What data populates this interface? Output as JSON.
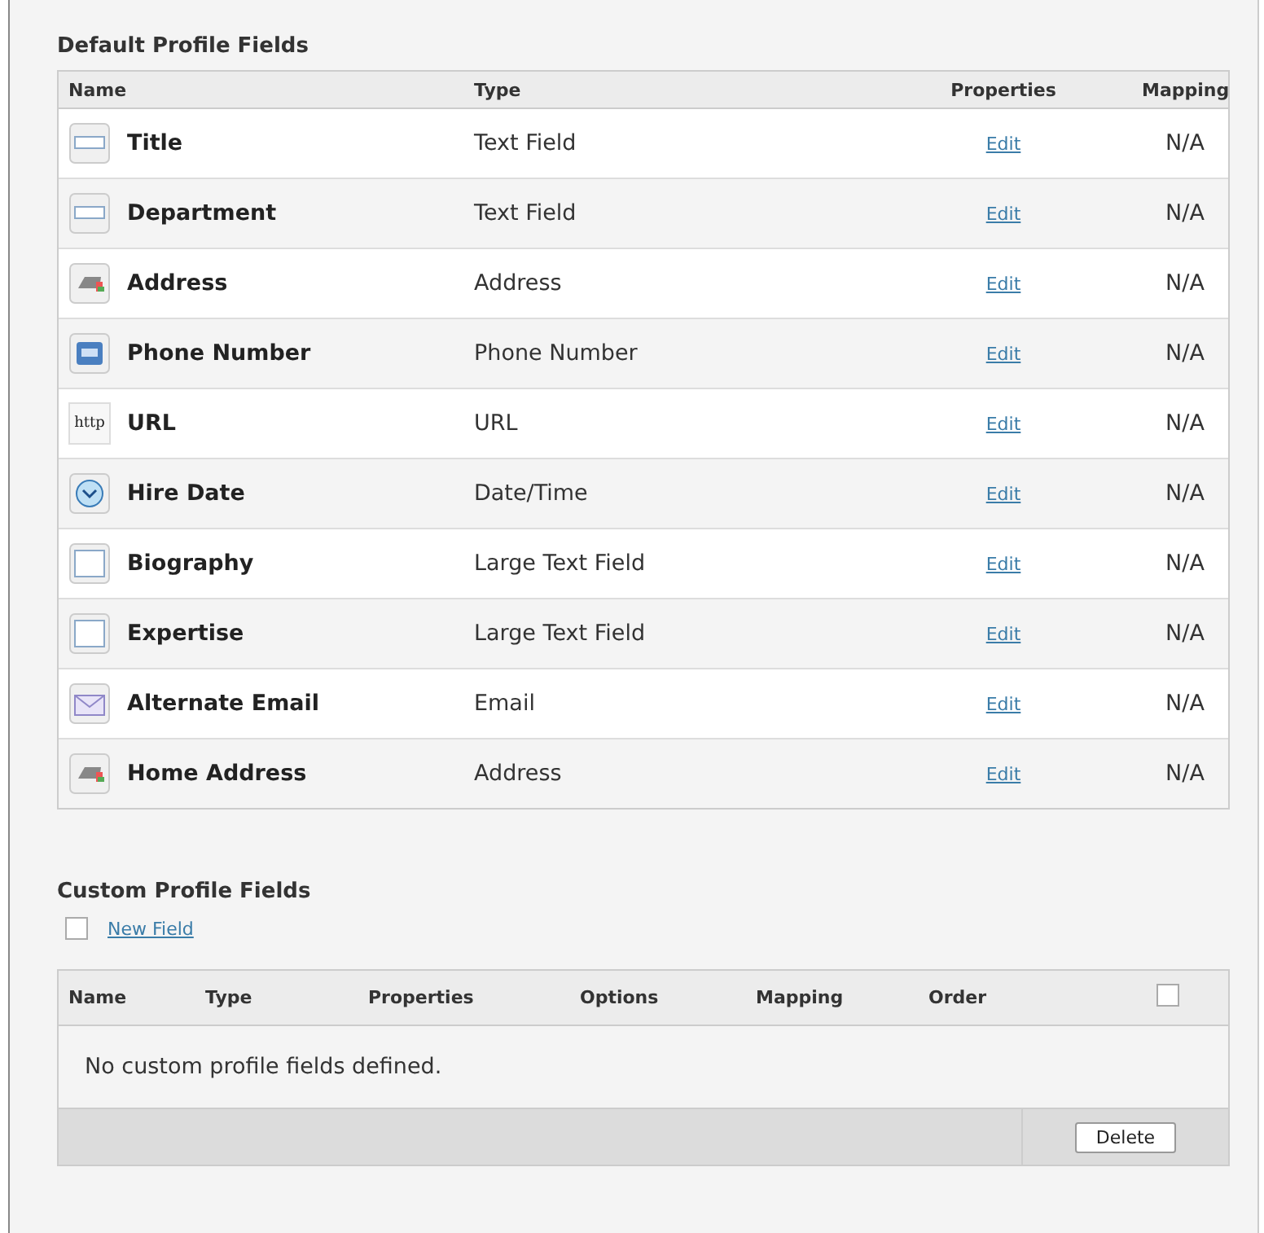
{
  "default_section": {
    "title": "Default Profile Fields",
    "columns": [
      "Name",
      "Type",
      "Properties",
      "Mapping"
    ],
    "rows": [
      {
        "kind": "text",
        "name": "Title",
        "type": "Text Field",
        "properties": "Edit",
        "mapping": "N/A"
      },
      {
        "kind": "text",
        "name": "Department",
        "type": "Text Field",
        "properties": "Edit",
        "mapping": "N/A"
      },
      {
        "kind": "address",
        "name": "Address",
        "type": "Address",
        "properties": "Edit",
        "mapping": "N/A"
      },
      {
        "kind": "phone",
        "name": "Phone Number",
        "type": "Phone Number",
        "properties": "Edit",
        "mapping": "N/A"
      },
      {
        "kind": "url",
        "name": "URL",
        "type": "URL",
        "properties": "Edit",
        "mapping": "N/A",
        "icon_text": "http"
      },
      {
        "kind": "date",
        "name": "Hire Date",
        "type": "Date/Time",
        "properties": "Edit",
        "mapping": "N/A"
      },
      {
        "kind": "textarea",
        "name": "Biography",
        "type": "Large Text Field",
        "properties": "Edit",
        "mapping": "N/A"
      },
      {
        "kind": "textarea",
        "name": "Expertise",
        "type": "Large Text Field",
        "properties": "Edit",
        "mapping": "N/A"
      },
      {
        "kind": "email",
        "name": "Alternate Email",
        "type": "Email",
        "properties": "Edit",
        "mapping": "N/A"
      },
      {
        "kind": "address",
        "name": "Home Address",
        "type": "Address",
        "properties": "Edit",
        "mapping": "N/A"
      }
    ]
  },
  "custom_section": {
    "title": "Custom Profile Fields",
    "new_field": {
      "label": "New Field",
      "checked": false
    },
    "columns": [
      "Name",
      "Type",
      "Properties",
      "Options",
      "Mapping",
      "Order"
    ],
    "select_all": {
      "checked": false
    },
    "empty_message": "No custom profile fields defined.",
    "delete_button": "Delete"
  }
}
